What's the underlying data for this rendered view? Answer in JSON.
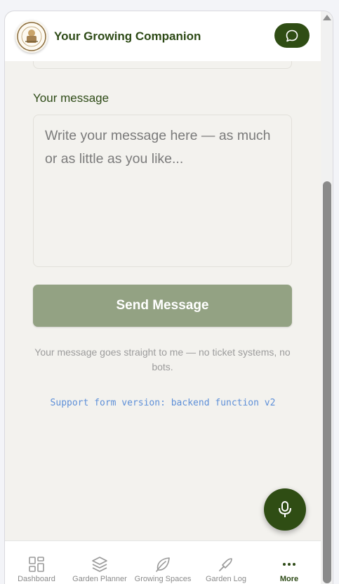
{
  "header": {
    "title": "Your Growing Companion",
    "logo_icon": "garden-logo-icon",
    "chat_icon": "chat-bubble-icon"
  },
  "form": {
    "message_label": "Your message",
    "message_placeholder": "Write your message here — as much or as little as you like...",
    "send_label": "Send Message",
    "note": "Your message goes straight to me — no ticket systems, no bots.",
    "version": "Support form version: backend function v2"
  },
  "fab": {
    "icon": "microphone-icon"
  },
  "nav": {
    "items": [
      {
        "label": "Dashboard",
        "icon": "dashboard-grid-icon",
        "active": false
      },
      {
        "label": "Garden Planner",
        "icon": "layers-icon",
        "active": false
      },
      {
        "label": "Growing Spaces",
        "icon": "leaf-icon",
        "active": false
      },
      {
        "label": "Garden Log",
        "icon": "trowel-icon",
        "active": false
      },
      {
        "label": "More",
        "icon": "more-dots-icon",
        "active": true
      }
    ]
  },
  "colors": {
    "brand": "#2f4d14",
    "button_disabled": "#93a283",
    "background": "#f3f2ee",
    "link": "#5d8fd8"
  }
}
